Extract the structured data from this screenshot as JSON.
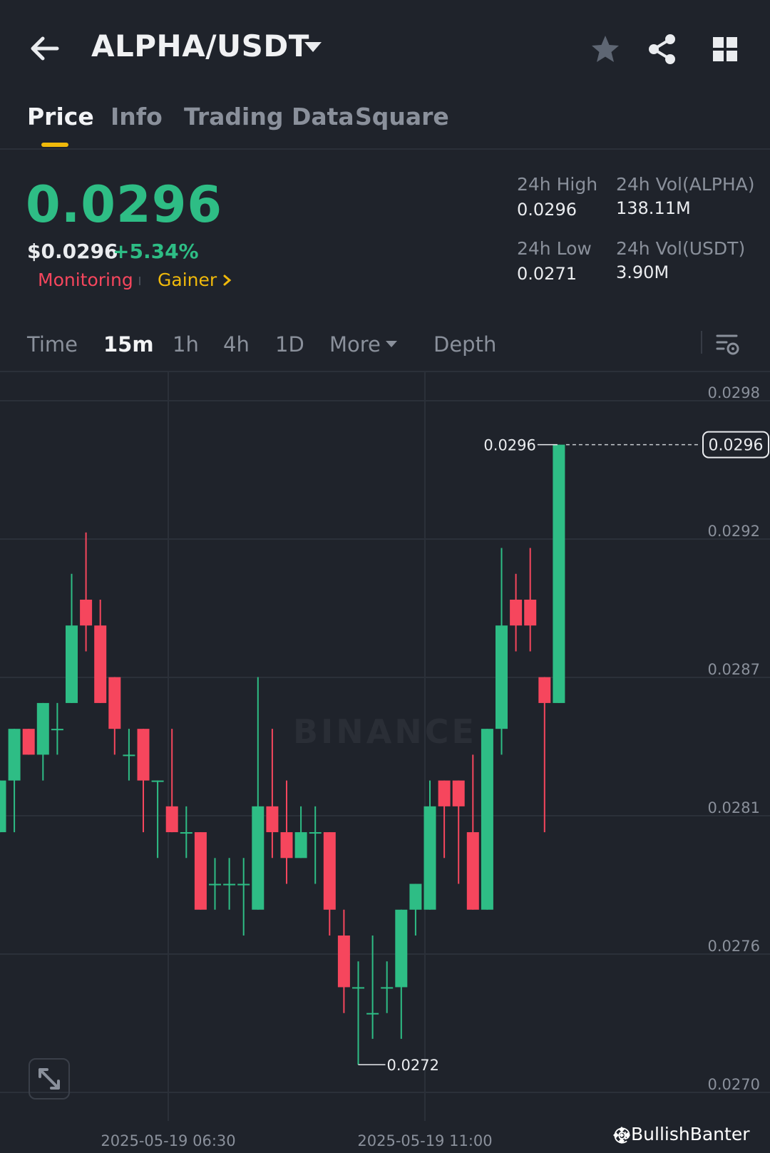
{
  "header": {
    "pair": "ALPHA/USDT",
    "icons": [
      "back-arrow-icon",
      "chevron-down-icon",
      "star-icon",
      "share-icon",
      "grid-icon"
    ]
  },
  "tabs": [
    {
      "label": "Price",
      "active": true
    },
    {
      "label": "Info",
      "active": false
    },
    {
      "label": "Trading Data",
      "active": false
    },
    {
      "label": "Square",
      "active": false
    }
  ],
  "ticker": {
    "last_price": "0.0296",
    "usd_price": "$0.0296",
    "change_pct": "+5.34%",
    "tags": {
      "monitoring": "Monitoring",
      "gainer": "Gainer"
    },
    "stats": {
      "high_label": "24h High",
      "high_value": "0.0296",
      "low_label": "24h Low",
      "low_value": "0.0271",
      "vol_base_label": "24h Vol(ALPHA)",
      "vol_base_value": "138.11M",
      "vol_quote_label": "24h Vol(USDT)",
      "vol_quote_value": "3.90M"
    },
    "colors": {
      "up": "#2ebd85",
      "down": "#f6465d",
      "accent": "#f0b90b"
    }
  },
  "intervals": {
    "items": [
      {
        "label": "Time",
        "active": false
      },
      {
        "label": "15m",
        "active": true
      },
      {
        "label": "1h",
        "active": false
      },
      {
        "label": "4h",
        "active": false
      },
      {
        "label": "1D",
        "active": false
      },
      {
        "label": "More",
        "active": false
      },
      {
        "label": "Depth",
        "active": false
      }
    ]
  },
  "watermark": {
    "brand": "BINANCE",
    "handle": "@BullishBanter"
  },
  "chart_data": {
    "type": "candlestick",
    "y_ticks": [
      "0.0298",
      "0.0292",
      "0.0287",
      "0.0281",
      "0.0276",
      "0.0270"
    ],
    "x_ticks": [
      "2025-05-19 06:30",
      "2025-05-19 11:00"
    ],
    "ylim": [
      0.02701,
      0.02977
    ],
    "grid": true,
    "last_price_label": "0.0296",
    "max_label": "0.0296",
    "min_label": "0.0272",
    "candles": [
      {
        "o": 0.0281,
        "h": 0.0283,
        "l": 0.0281,
        "c": 0.0283
      },
      {
        "o": 0.0283,
        "h": 0.0285,
        "l": 0.0281,
        "c": 0.0285
      },
      {
        "o": 0.0285,
        "h": 0.0285,
        "l": 0.0284,
        "c": 0.0284
      },
      {
        "o": 0.0284,
        "h": 0.0286,
        "l": 0.0283,
        "c": 0.0286
      },
      {
        "o": 0.0285,
        "h": 0.0286,
        "l": 0.0284,
        "c": 0.0285
      },
      {
        "o": 0.0286,
        "h": 0.0291,
        "l": 0.0286,
        "c": 0.0289
      },
      {
        "o": 0.029,
        "h": 0.02926,
        "l": 0.0288,
        "c": 0.0289
      },
      {
        "o": 0.0289,
        "h": 0.029,
        "l": 0.0286,
        "c": 0.0286
      },
      {
        "o": 0.0287,
        "h": 0.0287,
        "l": 0.0284,
        "c": 0.0285
      },
      {
        "o": 0.0284,
        "h": 0.0285,
        "l": 0.0283,
        "c": 0.0284
      },
      {
        "o": 0.0285,
        "h": 0.0285,
        "l": 0.0281,
        "c": 0.0283
      },
      {
        "o": 0.0283,
        "h": 0.0283,
        "l": 0.028,
        "c": 0.0283
      },
      {
        "o": 0.0282,
        "h": 0.0285,
        "l": 0.0281,
        "c": 0.0281
      },
      {
        "o": 0.0281,
        "h": 0.0282,
        "l": 0.028,
        "c": 0.0281
      },
      {
        "o": 0.0281,
        "h": 0.0281,
        "l": 0.0278,
        "c": 0.0278
      },
      {
        "o": 0.0279,
        "h": 0.028,
        "l": 0.0278,
        "c": 0.0279
      },
      {
        "o": 0.0279,
        "h": 0.028,
        "l": 0.0278,
        "c": 0.0279
      },
      {
        "o": 0.0279,
        "h": 0.028,
        "l": 0.0277,
        "c": 0.0279
      },
      {
        "o": 0.0278,
        "h": 0.0287,
        "l": 0.0278,
        "c": 0.0282
      },
      {
        "o": 0.0282,
        "h": 0.0285,
        "l": 0.028,
        "c": 0.0281
      },
      {
        "o": 0.0281,
        "h": 0.0283,
        "l": 0.0279,
        "c": 0.028
      },
      {
        "o": 0.028,
        "h": 0.0282,
        "l": 0.028,
        "c": 0.0281
      },
      {
        "o": 0.0281,
        "h": 0.0282,
        "l": 0.0279,
        "c": 0.0281
      },
      {
        "o": 0.0281,
        "h": 0.0281,
        "l": 0.0277,
        "c": 0.0278
      },
      {
        "o": 0.0277,
        "h": 0.0278,
        "l": 0.0274,
        "c": 0.0275
      },
      {
        "o": 0.0275,
        "h": 0.0276,
        "l": 0.0272,
        "c": 0.0275
      },
      {
        "o": 0.0274,
        "h": 0.0277,
        "l": 0.0273,
        "c": 0.0274
      },
      {
        "o": 0.0275,
        "h": 0.0276,
        "l": 0.0274,
        "c": 0.0275
      },
      {
        "o": 0.0275,
        "h": 0.0278,
        "l": 0.0273,
        "c": 0.0278
      },
      {
        "o": 0.0278,
        "h": 0.0279,
        "l": 0.0277,
        "c": 0.0279
      },
      {
        "o": 0.0278,
        "h": 0.0283,
        "l": 0.0278,
        "c": 0.0282
      },
      {
        "o": 0.0283,
        "h": 0.0283,
        "l": 0.028,
        "c": 0.0282
      },
      {
        "o": 0.0283,
        "h": 0.0283,
        "l": 0.0279,
        "c": 0.0282
      },
      {
        "o": 0.0281,
        "h": 0.0284,
        "l": 0.0278,
        "c": 0.0278
      },
      {
        "o": 0.0278,
        "h": 0.0285,
        "l": 0.0278,
        "c": 0.0285
      },
      {
        "o": 0.0285,
        "h": 0.0292,
        "l": 0.0284,
        "c": 0.0289
      },
      {
        "o": 0.029,
        "h": 0.0291,
        "l": 0.0288,
        "c": 0.0289
      },
      {
        "o": 0.029,
        "h": 0.0292,
        "l": 0.0288,
        "c": 0.0289
      },
      {
        "o": 0.0287,
        "h": 0.0287,
        "l": 0.0281,
        "c": 0.0286
      },
      {
        "o": 0.0286,
        "h": 0.0296,
        "l": 0.0286,
        "c": 0.0296
      }
    ]
  }
}
